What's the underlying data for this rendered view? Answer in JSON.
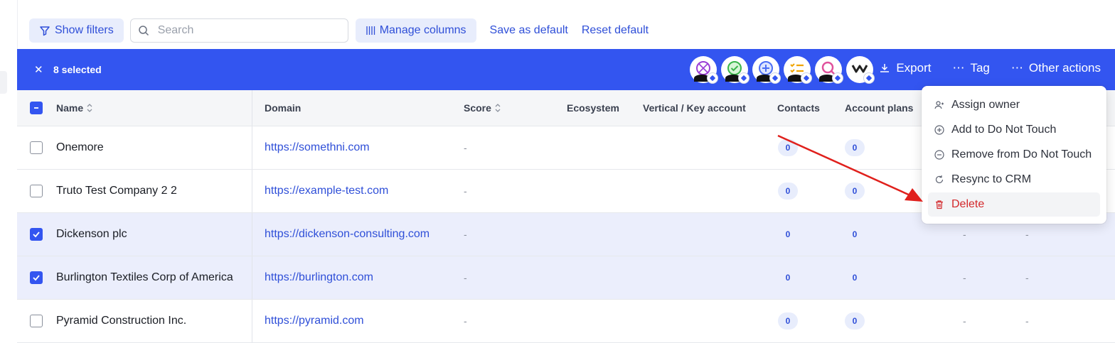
{
  "toolbar": {
    "show_filters": "Show filters",
    "search_placeholder": "Search",
    "manage_columns": "Manage columns",
    "save_default": "Save as default",
    "reset_default": "Reset default"
  },
  "selection": {
    "count_label": "8 selected",
    "actions": {
      "export": "Export",
      "tag": "Tag",
      "other": "Other actions"
    },
    "avatars": [
      "no-entry-icon",
      "check-circle-icon",
      "plus-circle-icon",
      "checklist-icon",
      "search-icon",
      "wave-logo-icon"
    ]
  },
  "table": {
    "headers": {
      "name": "Name",
      "domain": "Domain",
      "score": "Score",
      "ecosystem": "Ecosystem",
      "vertical": "Vertical / Key account",
      "contacts": "Contacts",
      "account_plans": "Account plans"
    },
    "rows": [
      {
        "name": "Onemore",
        "domain": "https://somethni.com",
        "score": "-",
        "contacts": "0",
        "plans": "0",
        "selected": false
      },
      {
        "name": "Truto Test Company 2 2",
        "domain": "https://example-test.com",
        "score": "-",
        "contacts": "0",
        "plans": "0",
        "selected": false
      },
      {
        "name": "Dickenson plc",
        "domain": "https://dickenson-consulting.com",
        "score": "-",
        "contacts": "0",
        "plans": "0",
        "extra1": "-",
        "extra2": "-",
        "selected": true
      },
      {
        "name": "Burlington Textiles Corp of America",
        "domain": "https://burlington.com",
        "score": "-",
        "contacts": "0",
        "plans": "0",
        "extra1": "-",
        "extra2": "-",
        "selected": true
      },
      {
        "name": "Pyramid Construction Inc.",
        "domain": "https://pyramid.com",
        "score": "-",
        "contacts": "0",
        "plans": "0",
        "extra1": "-",
        "extra2": "-",
        "selected": false
      }
    ]
  },
  "menu": {
    "items": [
      "Assign owner",
      "Add to Do Not Touch",
      "Remove from Do Not Touch",
      "Resync to CRM",
      "Delete"
    ]
  },
  "colors": {
    "accent": "#3355f0",
    "link": "#2f4fd8",
    "danger": "#d3282b",
    "selected_row": "#ebeefc",
    "annotation_arrow": "#e0201c"
  }
}
